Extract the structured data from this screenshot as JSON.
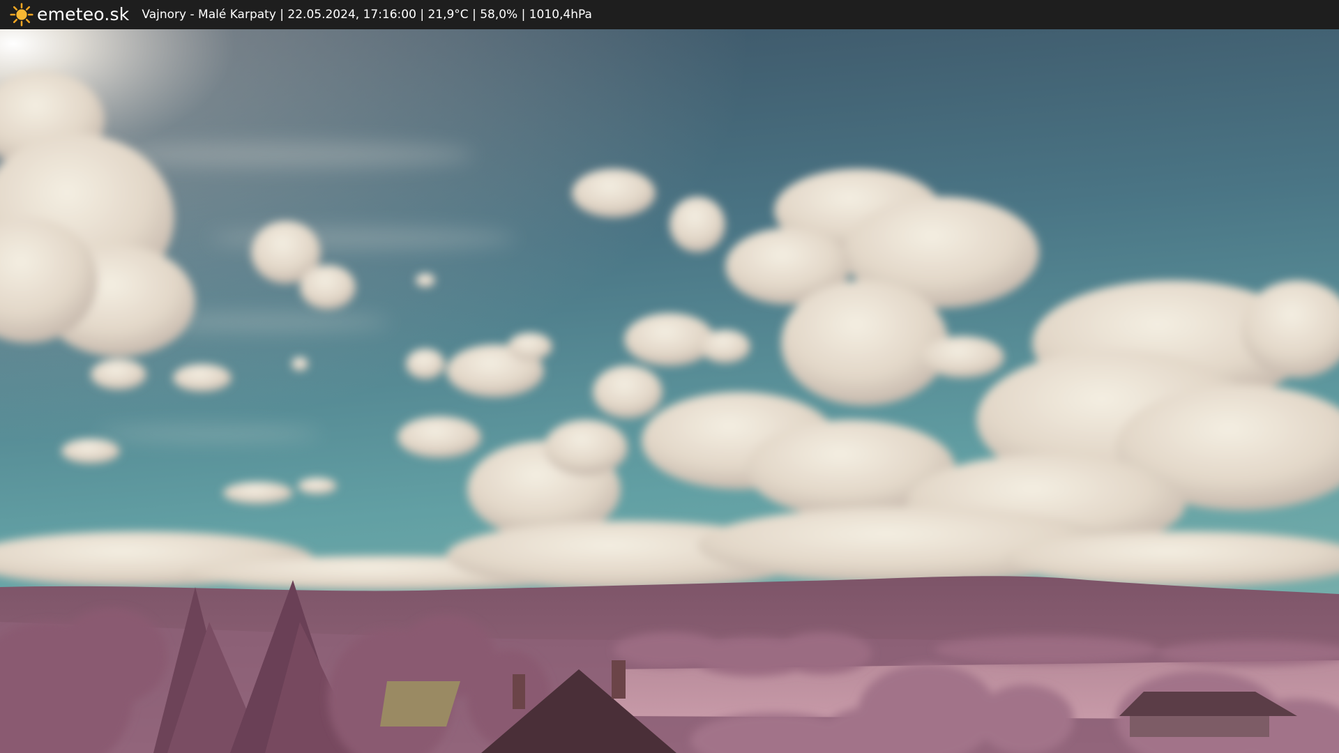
{
  "site": {
    "brand": "emeteo.sk",
    "logo_icon": "sun-icon"
  },
  "status_line": "Vajnory - Malé Karpaty | 22.05.2024, 17:16:00 | 21,9°C | 58,0% | 1010,4hPa",
  "colors": {
    "bar_background": "#1e1e1e",
    "sun": "#f5a623",
    "sky_top": "#3e5566",
    "sky_bottom": "#6aa7a8",
    "hills": "#8a5f74",
    "foliage": "#9e6f86"
  }
}
